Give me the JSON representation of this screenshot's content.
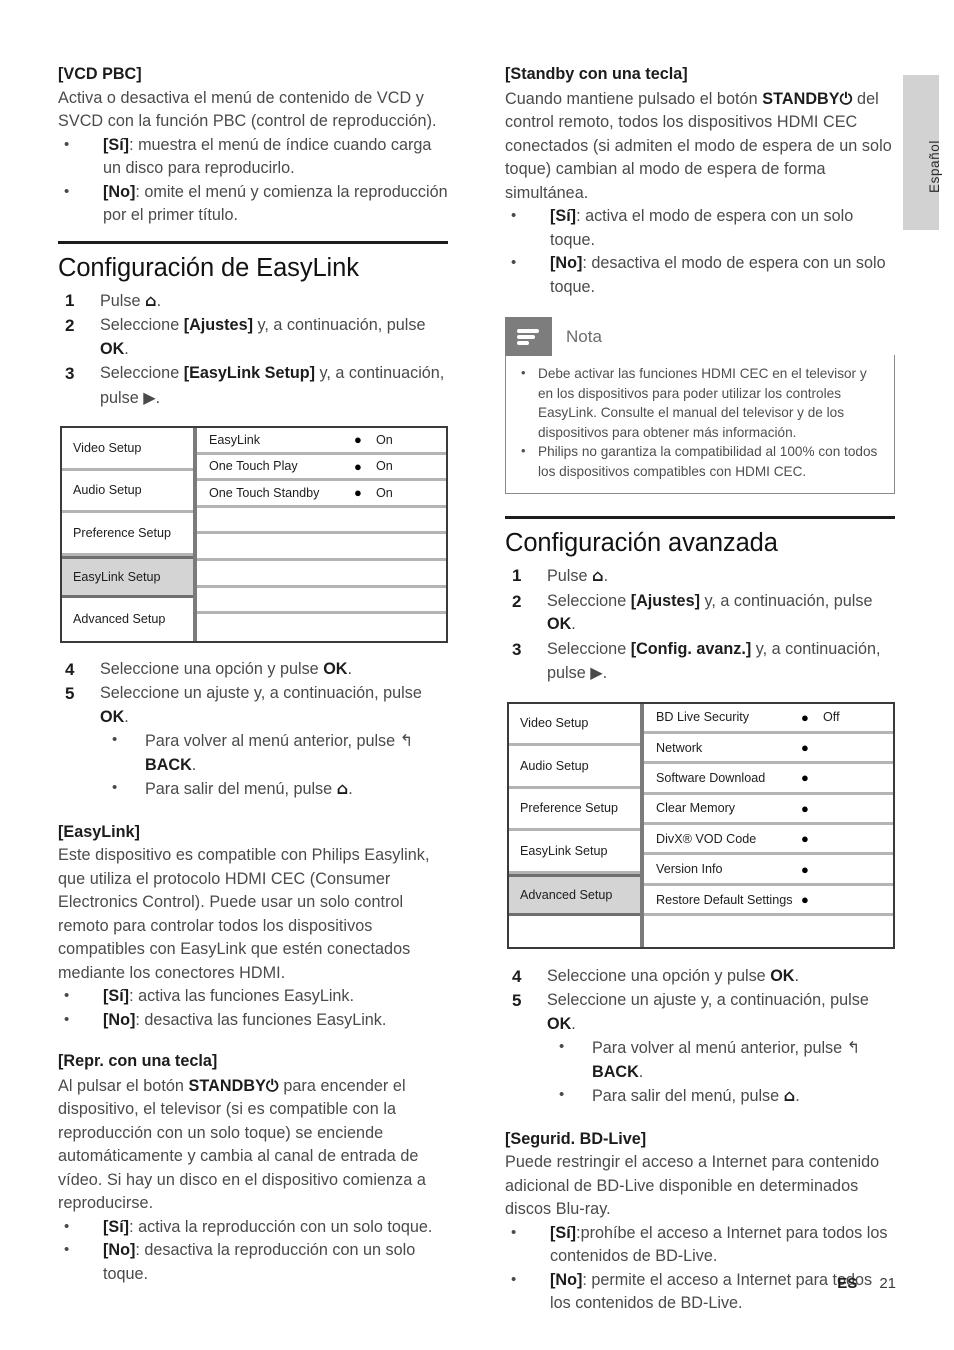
{
  "side_tab": {
    "label": "Español"
  },
  "footer": {
    "lang_code": "ES",
    "page_number": "21"
  },
  "left_column": {
    "vcd": {
      "heading": "[VCD PBC]",
      "body": "Activa o desactiva el menú de contenido de VCD y SVCD con la función PBC (control de reproducción).",
      "bullets": [
        {
          "term": "[Sí]",
          "text": ": muestra el menú de índice cuando carga un disco para reproducirlo."
        },
        {
          "term": "[No]",
          "text": ": omite el menú y comienza la reproducción por el primer título."
        }
      ]
    },
    "easylink_section": {
      "title": "Configuración de EasyLink",
      "steps": [
        {
          "num": "1",
          "pre": "Pulse ",
          "icon": "home-icon",
          "post": "."
        },
        {
          "num": "2",
          "pre": "Seleccione ",
          "bold1": "[Ajustes]",
          "mid": " y, a continuación, pulse ",
          "bold2": "OK",
          "post": "."
        },
        {
          "num": "3",
          "pre": "Seleccione ",
          "bold1": "[EasyLink Setup]",
          "mid": " y, a continuación, pulse ",
          "icon": "right-arrow-icon",
          "post": "."
        }
      ],
      "steps_after": [
        {
          "num": "4",
          "pre": "Seleccione una opción y pulse ",
          "bold1": "OK",
          "post": "."
        },
        {
          "num": "5",
          "pre": "Seleccione un ajuste y, a continuación, pulse ",
          "bold1": "OK",
          "post": "."
        }
      ],
      "sub_bullets": [
        {
          "pre": "Para volver al menú anterior, pulse ",
          "icon": "back-arrow-icon",
          "bold": "BACK",
          "post": "."
        },
        {
          "pre": "Para salir del menú, pulse ",
          "icon": "home-icon",
          "post": "."
        }
      ]
    },
    "osd_easylink": {
      "left_items": [
        "Video Setup",
        "Audio Setup",
        "Preference Setup",
        "EasyLink Setup",
        "Advanced Setup"
      ],
      "selected_left": "EasyLink Setup",
      "rows": [
        {
          "label": "EasyLink",
          "dot": "●",
          "value": "On"
        },
        {
          "label": "One Touch Play",
          "dot": "●",
          "value": "On"
        },
        {
          "label": "One Touch Standby",
          "dot": "●",
          "value": "On"
        },
        {
          "label": "",
          "dot": "",
          "value": ""
        },
        {
          "label": "",
          "dot": "",
          "value": ""
        },
        {
          "label": "",
          "dot": "",
          "value": ""
        },
        {
          "label": "",
          "dot": "",
          "value": ""
        },
        {
          "label": "",
          "dot": "",
          "value": ""
        }
      ]
    },
    "easylink_desc": {
      "heading": "[EasyLink]",
      "body": "Este dispositivo es compatible con Philips Easylink, que utiliza el protocolo HDMI CEC (Consumer Electronics Control). Puede usar un solo control remoto para controlar todos los dispositivos compatibles con EasyLink que estén conectados mediante los conectores HDMI.",
      "bullets": [
        {
          "term": "[Sí]",
          "text": ": activa las funciones EasyLink."
        },
        {
          "term": "[No]",
          "text": ": desactiva las funciones EasyLink."
        }
      ]
    },
    "one_touch_play": {
      "heading": "[Repr. con una tecla]",
      "body_pre": "Al pulsar el botón ",
      "body_bold": "STANDBY",
      "body_icon": "power-icon",
      "body_post": " para encender el dispositivo, el televisor (si es compatible con la reproducción con un solo toque) se enciende automáticamente y cambia al canal de entrada de vídeo. Si hay un disco en el dispositivo comienza a reproducirse.",
      "bullets": [
        {
          "term": "[Sí]",
          "text": ": activa la reproducción con un solo toque."
        },
        {
          "term": "[No]",
          "text": ": desactiva la reproducción con un solo toque."
        }
      ]
    }
  },
  "right_column": {
    "one_touch_standby": {
      "heading": "[Standby con una tecla]",
      "body_pre": "Cuando mantiene pulsado el botón ",
      "body_bold": "STANDBY",
      "body_icon": "power-icon",
      "body_post": " del control remoto, todos los dispositivos HDMI CEC conectados (si admiten el modo de espera de un solo toque) cambian al modo de espera de forma simultánea.",
      "bullets": [
        {
          "term": "[Sí]",
          "text": ": activa el modo de espera con un solo toque."
        },
        {
          "term": "[No]",
          "text": ": desactiva el modo de espera con un solo toque."
        }
      ]
    },
    "note": {
      "icon": "note-lines-icon",
      "title": "Nota",
      "items": [
        "Debe activar las funciones HDMI CEC en el televisor y en los dispositivos para poder utilizar los controles EasyLink. Consulte el manual del televisor y de los dispositivos para obtener más información.",
        "Philips no garantiza la compatibilidad al 100% con todos los dispositivos compatibles con HDMI CEC."
      ]
    },
    "advanced_section": {
      "title": "Configuración avanzada",
      "steps": [
        {
          "num": "1",
          "pre": "Pulse ",
          "icon": "home-icon",
          "post": "."
        },
        {
          "num": "2",
          "pre": "Seleccione ",
          "bold1": "[Ajustes]",
          "mid": " y, a continuación, pulse ",
          "bold2": "OK",
          "post": "."
        },
        {
          "num": "3",
          "pre": "Seleccione ",
          "bold1": "[Config. avanz.]",
          "mid": " y, a continuación, pulse ",
          "icon": "right-arrow-icon",
          "post": "."
        }
      ],
      "steps_after": [
        {
          "num": "4",
          "pre": "Seleccione una opción y pulse ",
          "bold1": "OK",
          "post": "."
        },
        {
          "num": "5",
          "pre": "Seleccione un ajuste y, a continuación, pulse ",
          "bold1": "OK",
          "post": "."
        }
      ],
      "sub_bullets": [
        {
          "pre": "Para volver al menú anterior, pulse ",
          "icon": "back-arrow-icon",
          "bold": "BACK",
          "post": "."
        },
        {
          "pre": "Para salir del menú, pulse ",
          "icon": "home-icon",
          "post": "."
        }
      ]
    },
    "osd_advanced": {
      "left_items": [
        "Video Setup",
        "Audio Setup",
        "Preference Setup",
        "EasyLink Setup",
        "Advanced Setup"
      ],
      "selected_left": "Advanced Setup",
      "rows": [
        {
          "label": "BD Live Security",
          "dot": "●",
          "value": "Off"
        },
        {
          "label": "Network",
          "dot": "●",
          "value": ""
        },
        {
          "label": "Software Download",
          "dot": "●",
          "value": ""
        },
        {
          "label": "Clear Memory",
          "dot": "●",
          "value": ""
        },
        {
          "label": "DivX® VOD Code",
          "dot": "●",
          "value": ""
        },
        {
          "label": "Version Info",
          "dot": "●",
          "value": ""
        },
        {
          "label": "Restore Default Settings",
          "dot": "●",
          "value": ""
        },
        {
          "label": "",
          "dot": "",
          "value": ""
        }
      ]
    },
    "bd_live": {
      "heading": "[Segurid. BD-Live]",
      "body": "Puede restringir el acceso a Internet para contenido adicional de BD-Live disponible en determinados discos Blu-ray.",
      "bullets": [
        {
          "term": "[Sí]",
          "text": ":prohíbe el acceso a Internet para todos los contenidos de BD-Live."
        },
        {
          "term": "[No]",
          "text": ": permite el acceso a Internet para todos los contenidos de BD-Live."
        }
      ]
    }
  }
}
